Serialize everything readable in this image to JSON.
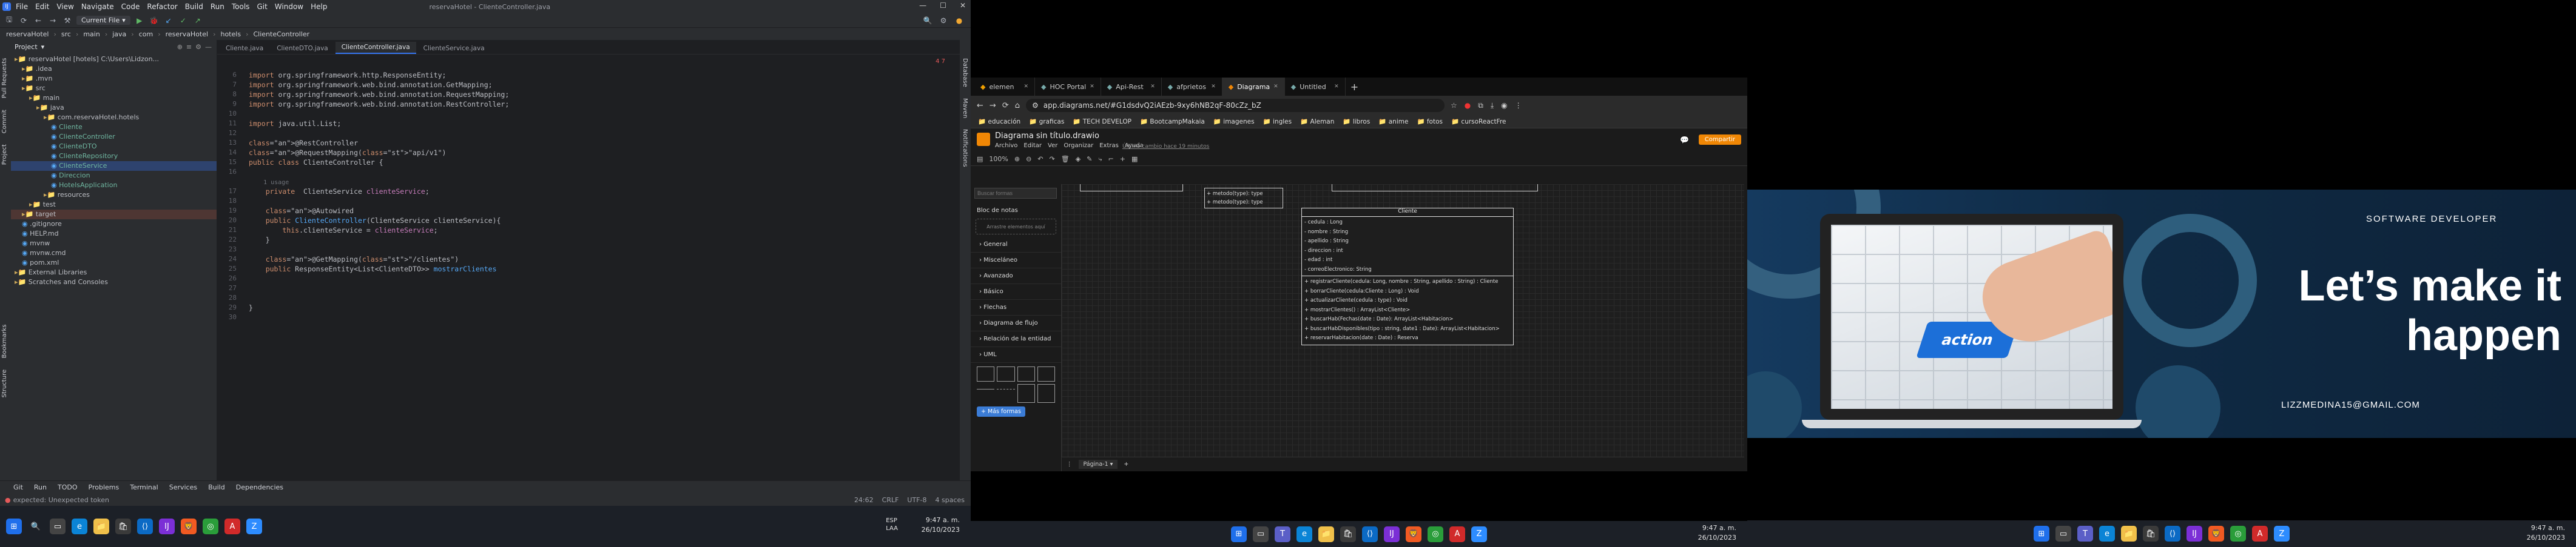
{
  "ide": {
    "menu": [
      "File",
      "Edit",
      "View",
      "Navigate",
      "Code",
      "Refactor",
      "Build",
      "Run",
      "Tools",
      "Git",
      "Window",
      "Help"
    ],
    "title_tab": "reservaHotel - ClienteController.java",
    "breadcrumbs": [
      "reservaHotel",
      "src",
      "main",
      "java",
      "com",
      "reservaHotel",
      "hotels",
      "ClienteController"
    ],
    "run_config": "Current File",
    "project_label": "Project",
    "tree": [
      {
        "t": "reservaHotel [hotels] C:\\Users\\Lidzon...",
        "d": 0
      },
      {
        "t": ".idea",
        "d": 1
      },
      {
        "t": ".mvn",
        "d": 1
      },
      {
        "t": "src",
        "d": 1
      },
      {
        "t": "main",
        "d": 2
      },
      {
        "t": "java",
        "d": 3
      },
      {
        "t": "com.reservaHotel.hotels",
        "d": 4
      },
      {
        "t": "Cliente",
        "d": 5
      },
      {
        "t": "ClienteController",
        "d": 5
      },
      {
        "t": "ClienteDTO",
        "d": 5
      },
      {
        "t": "ClienteRepository",
        "d": 5
      },
      {
        "t": "ClienteService",
        "d": 5
      },
      {
        "t": "Direccion",
        "d": 5
      },
      {
        "t": "HotelsApplication",
        "d": 5
      },
      {
        "t": "resources",
        "d": 4
      },
      {
        "t": "test",
        "d": 2
      },
      {
        "t": "target",
        "d": 1
      },
      {
        "t": ".gitignore",
        "d": 1
      },
      {
        "t": "HELP.md",
        "d": 1
      },
      {
        "t": "mvnw",
        "d": 1
      },
      {
        "t": "mvnw.cmd",
        "d": 1
      },
      {
        "t": "pom.xml",
        "d": 1
      },
      {
        "t": "External Libraries",
        "d": 0
      },
      {
        "t": "Scratches and Consoles",
        "d": 0
      }
    ],
    "tabs": [
      "Cliente.java",
      "ClienteDTO.java",
      "ClienteController.java",
      "ClienteService.java"
    ],
    "code": [
      "import org.springframework.http.ResponseEntity;",
      "import org.springframework.web.bind.annotation.GetMapping;",
      "import org.springframework.web.bind.annotation.RequestMapping;",
      "import org.springframework.web.bind.annotation.RestController;",
      "",
      "import java.util.List;",
      "",
      "@RestController",
      "@RequestMapping(\"api/v1\")",
      "public class ClienteController {",
      "",
      "    1 usage",
      "    private  ClienteService clienteService;",
      "",
      "    @Autowired",
      "    public ClienteController(ClienteService clienteService){",
      "        this.clienteService = clienteService;",
      "    }",
      "",
      "    @GetMapping(\"/clientes\")",
      "    public ResponseEntity<List<ClienteDTO>> mostrarClientes",
      "",
      "",
      "",
      "}",
      ""
    ],
    "line_numbers": [
      "6",
      "7",
      "8",
      "9",
      "10",
      "11",
      "12",
      "13",
      "14",
      "15",
      "16",
      "",
      "17",
      "18",
      "19",
      "20",
      "21",
      "22",
      "23",
      "24",
      "25",
      "26",
      "27",
      "28",
      "29",
      "30"
    ],
    "inspection": "4  7",
    "bottom_tools": [
      "Git",
      "Run",
      "TODO",
      "Problems",
      "Terminal",
      "Services",
      "Build",
      "Dependencies"
    ],
    "status_left": "expected: Unexpected token",
    "status_right": [
      "24:62",
      "CRLF",
      "UTF-8",
      "4 spaces"
    ],
    "left_strip": [
      "Project",
      "Commit",
      "Pull Requests"
    ],
    "right_strip": [
      "Database",
      "Maven",
      "Notifications"
    ],
    "left_strip_bottom": [
      "Structure",
      "Bookmarks"
    ],
    "clock": {
      "time": "9:47 a. m.",
      "date": "26/10/2023"
    },
    "lang": "ESP\nLAA"
  },
  "browser": {
    "tabs": [
      "elemen",
      "HOC Portal",
      "Api-Rest",
      "afprietos",
      "Diagrama",
      "Untitled"
    ],
    "address": "app.diagrams.net/#G1dsdvQ2iAEzb-9xy6hNB2qF-80cZz_bZ",
    "bookmarks": [
      "educación",
      "graficas",
      "TECH DEVELOP",
      "BootcampMakaia",
      "imagenes",
      "ingles",
      "Aleman",
      "libros",
      "anime",
      "fotos",
      "cursoReactFre"
    ],
    "doc_title": "Diagrama sin título.drawio",
    "doc_menu": [
      "Archivo",
      "Editar",
      "Ver",
      "Organizar",
      "Extras",
      "Ayuda"
    ],
    "doc_saved": "Último cambio hace 19 minutos",
    "share": "Compartir",
    "zoom": "100%",
    "search_placeholder": "Buscar formas",
    "scratchpad": "Bloc de notas",
    "drop_hint": "Arrastre elementos aquí",
    "shape_groups": [
      "General",
      "Misceláneo",
      "Avanzado",
      "Básico",
      "Flechas",
      "Diagrama de flujo",
      "Relación de la entidad",
      "UML"
    ],
    "more_shapes": "+ Más formas",
    "page_tab": "Página-1",
    "methods": [
      "+ metodo(type): type",
      "+ metodo(type): type"
    ],
    "class": {
      "name": "Cliente",
      "attrs": [
        "- cedula : Long",
        "- nombre : String",
        "- apellido : String",
        "- direccion : int",
        "- edad : int",
        "- correoElectronico: String"
      ],
      "ops": [
        "+ registrarCliente(cedula: Long, nombre : String, apellido : String) : Cliente",
        "+ borrarCliente(cedula:Cliente : Long) : Void",
        "+ actualizarCliente(cedula : type) : Void",
        "+ mostrarClientes() : ArrayList<Cliente>",
        "+ buscarHab(Fechas(date : Date): ArrayList<Habitacion>",
        "+ buscarHabDisponibles(tipo : string, date1 : Date): ArrayList<Habitacion>",
        "+ reservarHabitacion(date : Date) : Reserva"
      ]
    },
    "clock": {
      "time": "9:47 a. m.",
      "date": "26/10/2023"
    }
  },
  "wallpaper": {
    "subtitle": "SOFTWARE DEVELOPER",
    "headline1": "Let’s make it",
    "headline2": "happen",
    "email": "LIZZMEDINA15@GMAIL.COM",
    "key_label": "action",
    "clock": {
      "time": "9:47 a. m.",
      "date": "26/10/2023"
    }
  },
  "colors": {
    "ide_bg": "#1e1f22",
    "wallpaper_bg": "#0f2a44",
    "accent_orange": "#f08705"
  }
}
